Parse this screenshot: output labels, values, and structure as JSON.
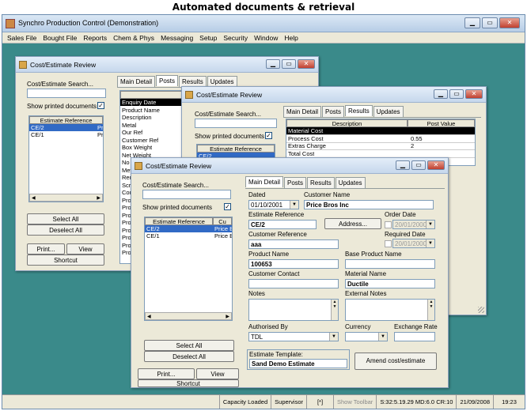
{
  "caption": "Automated documents & retrieval",
  "app": {
    "title": "Synchro Production Control (Demonstration)",
    "menu": [
      "Sales File",
      "Bought File",
      "Reports",
      "Chem & Phys",
      "Messaging",
      "Setup",
      "Security",
      "Window",
      "Help"
    ],
    "status": [
      "Capacity Loaded",
      "Supervisor",
      "[*]",
      "Show Toolbar",
      "S:32:5.19.29 MD:6.0 CR:10",
      "21/09/2008",
      "19:23"
    ]
  },
  "win1": {
    "title": "Cost/Estimate Review",
    "search_label": "Cost/Estimate Search...",
    "show_printed": "Show printed documents",
    "list_header": "Estimate Reference",
    "list": [
      {
        "ref": "CE/2",
        "c": "Pr"
      },
      {
        "ref": "CE/1",
        "c": "Pr"
      }
    ],
    "select_all": "Select All",
    "deselect_all": "Deselect All",
    "print": "Print...",
    "view": "View",
    "shortcut": "Shortcut",
    "tabs": [
      "Main Detail",
      "Posts",
      "Results",
      "Updates"
    ],
    "col_header": "Descri",
    "rows": [
      "Enquiry Date",
      "Product Name",
      "Description",
      "Metal",
      "Our Ref",
      "Customer Ref",
      "Box Weight",
      "Net Weight",
      "No P",
      "Met",
      "Rem",
      "Scra",
      "Com",
      "Proc",
      "Proc",
      "Proc",
      "Proc",
      "Proc",
      "Proc",
      "Proc",
      "Proc"
    ]
  },
  "win2": {
    "title": "Cost/Estimate Review",
    "search_label": "Cost/Estimate Search...",
    "show_printed": "Show printed documents",
    "list_header": "Estimate Reference",
    "list_first": "CE/2",
    "tabs": [
      "Main Detail",
      "Posts",
      "Results",
      "Updates"
    ],
    "col_desc": "Description",
    "col_post": "Post Value",
    "rows": [
      {
        "d": "Material Cost",
        "v": ""
      },
      {
        "d": "Process Cost",
        "v": "0.55"
      },
      {
        "d": "Extras Charge",
        "v": "2"
      },
      {
        "d": "Total Cost",
        "v": ""
      }
    ]
  },
  "win3": {
    "title": "Cost/Estimate Review",
    "search_label": "Cost/Estimate Search...",
    "show_printed": "Show printed documents",
    "list_header": "Estimate Reference",
    "list_header2": "Cu",
    "list": [
      {
        "ref": "CE/2",
        "c": "Price B"
      },
      {
        "ref": "CE/1",
        "c": "Price B"
      }
    ],
    "select_all": "Select All",
    "deselect_all": "Deselect All",
    "print": "Print...",
    "view": "View",
    "shortcut": "Shortcut",
    "tabs": [
      "Main Detail",
      "Posts",
      "Results",
      "Updates"
    ],
    "dated_label": "Dated",
    "dated": "01/10/2001",
    "customer_name_label": "Customer Name",
    "customer_name": "Price Bros Inc",
    "estimate_ref_label": "Estimate Reference",
    "estimate_ref": "CE/2",
    "address_btn": "Address...",
    "order_date_label": "Order Date",
    "order_date": "20/01/2000",
    "customer_ref_label": "Customer Reference",
    "customer_ref": "aaa",
    "required_date_label": "Required Date",
    "required_date": "20/01/2000",
    "product_name_label": "Product Name",
    "product_name": "100653",
    "base_product_label": "Base Product Name",
    "customer_contact_label": "Customer Contact",
    "material_name_label": "Material Name",
    "material_name": "Ductile",
    "notes_label": "Notes",
    "external_notes_label": "External Notes",
    "authorised_label": "Authorised By",
    "authorised": "TDL",
    "currency_label": "Currency",
    "exchange_label": "Exchange Rate",
    "template_label": "Estimate Template:",
    "template": "Sand Demo Estimate",
    "amend_btn": "Amend cost/estimate"
  }
}
